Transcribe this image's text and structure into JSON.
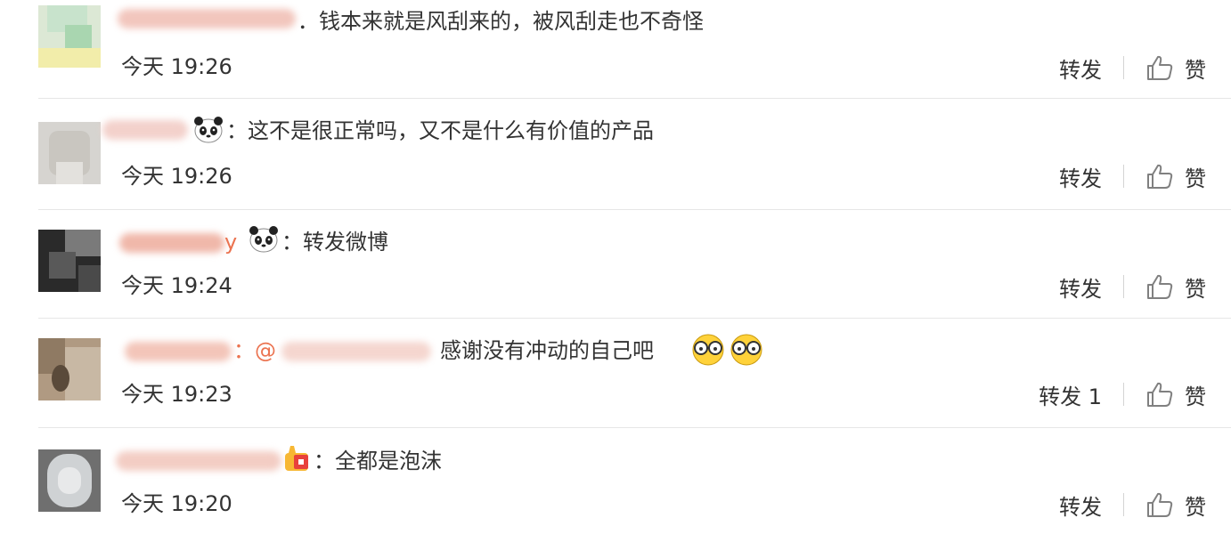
{
  "comments": [
    {
      "text": "．钱本来就是风刮来的，被风刮走也不奇怪",
      "time": "今天 19:26",
      "repost_label": "转发",
      "like_label": "赞"
    },
    {
      "text": "：这不是很正常吗，又不是什么有价值的产品",
      "time": "今天 19:26",
      "repost_label": "转发",
      "like_label": "赞"
    },
    {
      "partial_name": "y",
      "text": "：转发微博",
      "time": "今天 19:24",
      "repost_label": "转发",
      "like_label": "赞"
    },
    {
      "partial_name": "：@",
      "text": "感谢没有冲动的自己吧",
      "time": "今天 19:23",
      "repost_label": "转发 1",
      "like_label": "赞"
    },
    {
      "text": "：全都是泡沫",
      "time": "今天 19:20",
      "repost_label": "转发",
      "like_label": "赞"
    }
  ],
  "icons": {
    "like": "thumbs-up-icon",
    "panda": "panda-emoji-icon",
    "glasses_face": "glasses-face-emoji-icon",
    "badge": "gift-badge-icon"
  },
  "colors": {
    "text": "#333333",
    "username": "#eb7350",
    "divider": "#e6e6e6",
    "icon_stroke": "#808080"
  }
}
